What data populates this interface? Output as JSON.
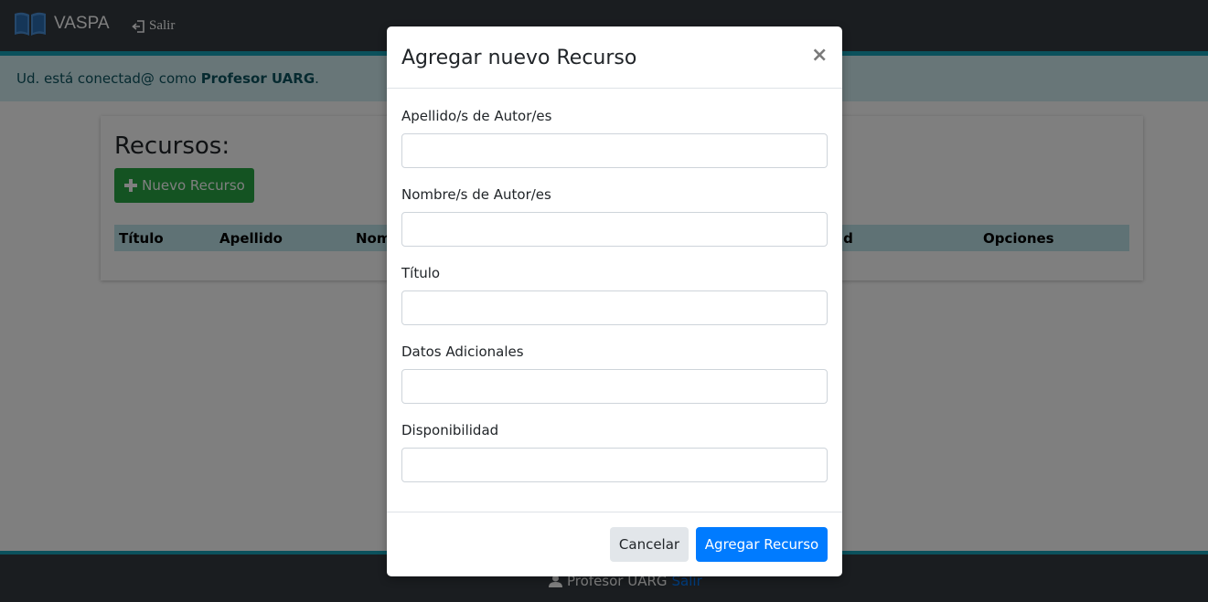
{
  "navbar": {
    "brand": "VASPA",
    "logout_label": "Salir"
  },
  "alert": {
    "prefix": "Ud. está conectad@ como ",
    "user": "Profesor UARG",
    "suffix": "."
  },
  "page": {
    "title": "Recursos:",
    "new_button": "Nuevo Recurso",
    "table_headers": [
      "Título",
      "Apellido",
      "Nom",
      "ad",
      "Opciones"
    ]
  },
  "footer": {
    "user": "Profesor UARG",
    "logout_label": "Salir"
  },
  "modal": {
    "title": "Agregar nuevo Recurso",
    "close": "×",
    "fields": [
      {
        "label": "Apellido/s de Autor/es",
        "value": "",
        "placeholder": ""
      },
      {
        "label": "Nombre/s de Autor/es",
        "value": "",
        "placeholder": ""
      },
      {
        "label": "Título",
        "value": "",
        "placeholder": ""
      },
      {
        "label": "Datos Adicionales",
        "value": "",
        "placeholder": ""
      },
      {
        "label": "Disponibilidad",
        "value": "",
        "placeholder": ""
      }
    ],
    "cancel_button": "Cancelar",
    "submit_button": "Agregar Recurso"
  },
  "colors": {
    "navbar": "#343a40",
    "accent": "#17a2b8",
    "alert_bg": "#d1ecf1",
    "success": "#28a745",
    "primary": "#007bff"
  },
  "icons": [
    "book-icon",
    "sign-out-icon",
    "plus-icon",
    "user-icon"
  ]
}
